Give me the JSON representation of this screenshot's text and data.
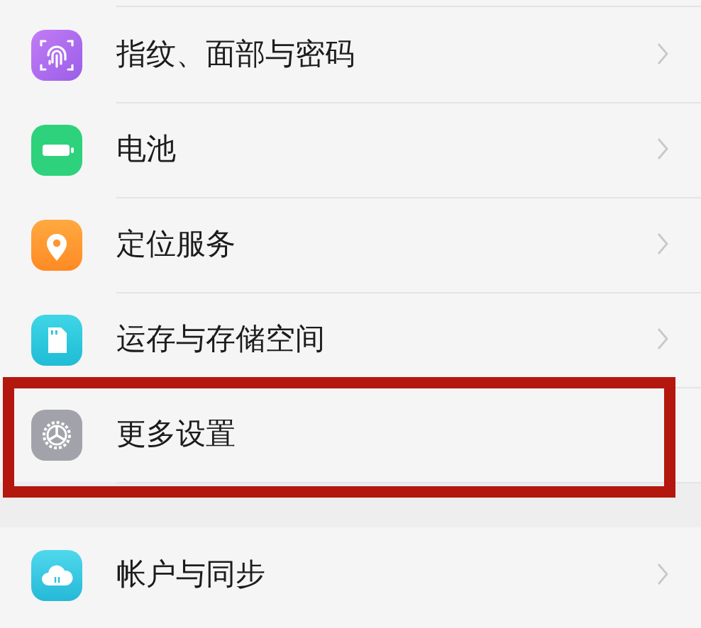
{
  "groups": [
    {
      "items": [
        {
          "kind": "fingerprint",
          "label": "指纹、面部与密码",
          "chevron": true,
          "highlighted": false
        },
        {
          "kind": "battery",
          "label": "电池",
          "chevron": true,
          "highlighted": false
        },
        {
          "kind": "location",
          "label": "定位服务",
          "chevron": true,
          "highlighted": false
        },
        {
          "kind": "storage",
          "label": "运存与存储空间",
          "chevron": true,
          "highlighted": false
        },
        {
          "kind": "gear",
          "label": "更多设置",
          "chevron": false,
          "highlighted": true
        }
      ]
    },
    {
      "items": [
        {
          "kind": "cloud",
          "label": "帐户与同步",
          "chevron": true,
          "highlighted": false
        }
      ]
    }
  ]
}
